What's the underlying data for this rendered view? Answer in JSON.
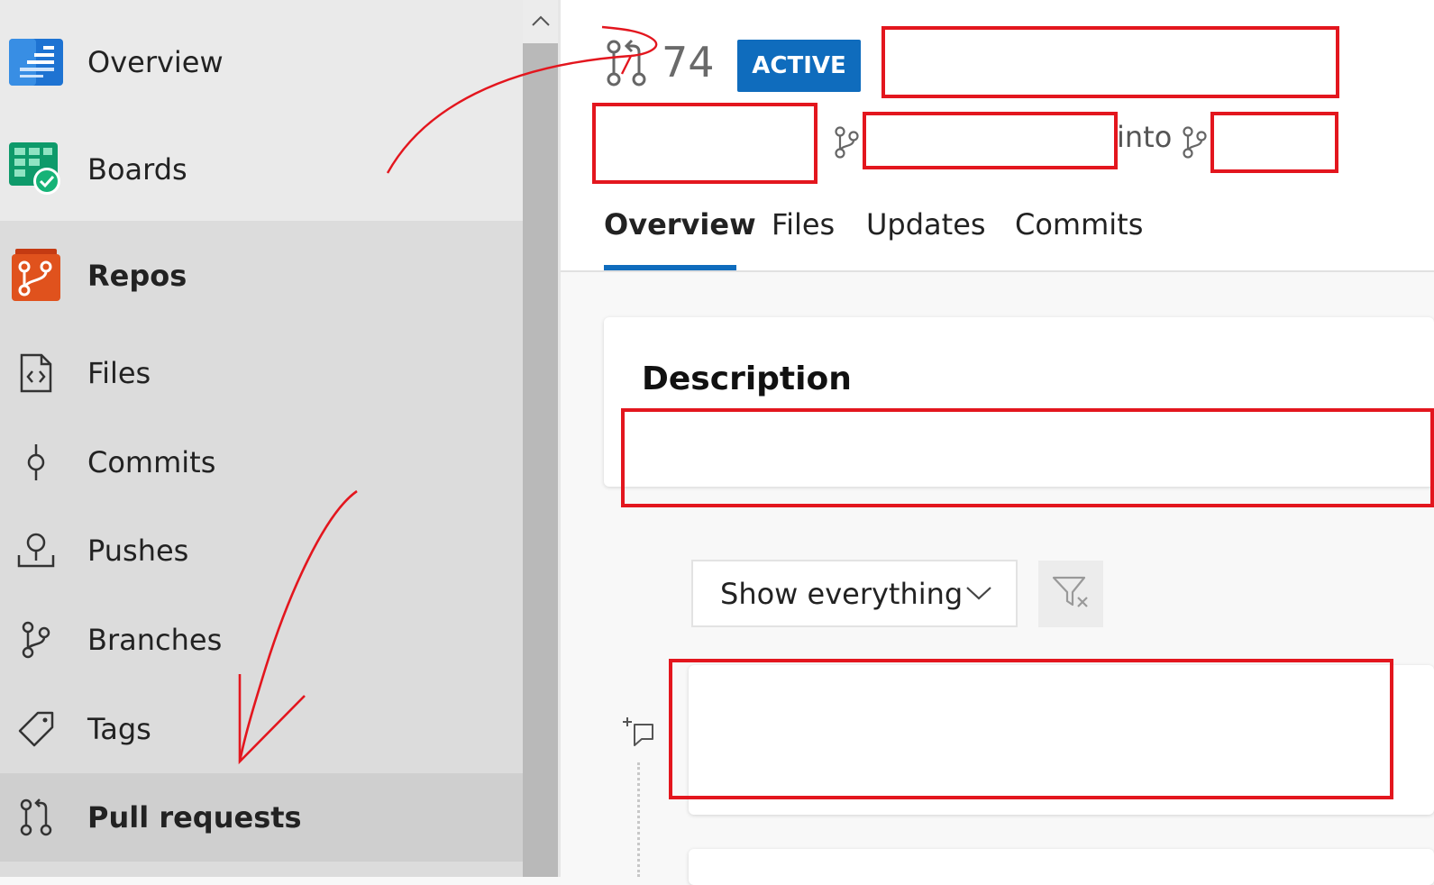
{
  "sidebar": {
    "items": [
      {
        "label": "Overview",
        "icon": "overview-icon"
      },
      {
        "label": "Boards",
        "icon": "boards-icon"
      },
      {
        "label": "Repos",
        "icon": "repos-icon"
      },
      {
        "label": "Files",
        "icon": "file-code-icon"
      },
      {
        "label": "Commits",
        "icon": "commit-icon"
      },
      {
        "label": "Pushes",
        "icon": "push-icon"
      },
      {
        "label": "Branches",
        "icon": "branch-icon"
      },
      {
        "label": "Tags",
        "icon": "tag-icon"
      },
      {
        "label": "Pull requests",
        "icon": "pull-request-icon"
      }
    ],
    "selected": "Pull requests"
  },
  "pull_request": {
    "number": "74",
    "status": "ACTIVE",
    "into_label": "into"
  },
  "tabs": [
    {
      "label": "Overview",
      "active": true
    },
    {
      "label": "Files"
    },
    {
      "label": "Updates"
    },
    {
      "label": "Commits"
    }
  ],
  "description": {
    "title": "Description"
  },
  "activity": {
    "filter_value": "Show everything"
  },
  "colors": {
    "accent": "#0f6cbd",
    "annotation": "#e3161e"
  }
}
